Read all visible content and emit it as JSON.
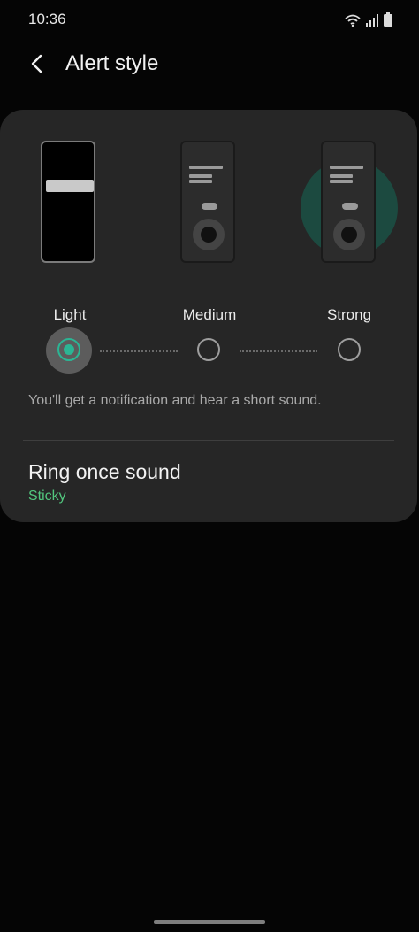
{
  "status_bar": {
    "time": "10:36",
    "icons": [
      "wifi-icon",
      "signal-icon",
      "battery-icon"
    ]
  },
  "header": {
    "back_icon": "chevron-left-icon",
    "title": "Alert style"
  },
  "alert_options": {
    "selected": "Light",
    "items": [
      {
        "label": "Light"
      },
      {
        "label": "Medium"
      },
      {
        "label": "Strong"
      }
    ]
  },
  "description": "You'll get a notification and hear a short sound.",
  "sound_setting": {
    "title": "Ring once sound",
    "value": "Sticky"
  },
  "colors": {
    "accent": "#2bb594",
    "value_text": "#52c77e",
    "card_bg": "#262626",
    "page_bg": "#050505"
  }
}
